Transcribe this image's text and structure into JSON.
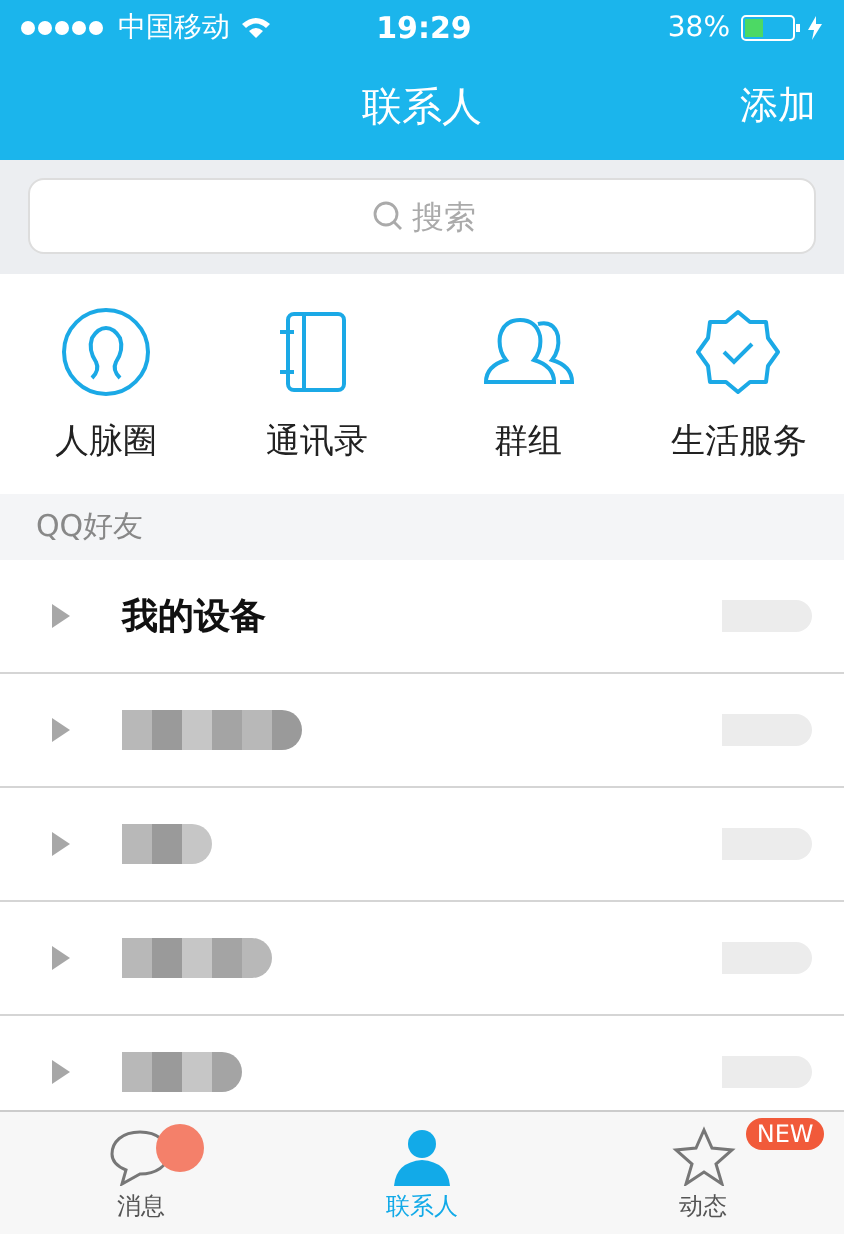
{
  "status_bar": {
    "carrier": "中国移动",
    "time": "19:29",
    "battery": "38%"
  },
  "nav": {
    "title": "联系人",
    "action": "添加"
  },
  "search": {
    "placeholder": "搜索"
  },
  "shortcuts": [
    {
      "label": "人脉圈",
      "kind": "circle"
    },
    {
      "label": "通讯录",
      "kind": "book"
    },
    {
      "label": "群组",
      "kind": "group"
    },
    {
      "label": "生活服务",
      "kind": "badge"
    }
  ],
  "section": "QQ好友",
  "groups": [
    {
      "kind": "named",
      "name": "我的设备"
    },
    {
      "kind": "blurred"
    },
    {
      "kind": "blurred"
    },
    {
      "kind": "blurred"
    },
    {
      "kind": "blurred"
    }
  ],
  "tabs": [
    {
      "label": "消息",
      "kind": "chat",
      "selected": false,
      "dot": true
    },
    {
      "label": "联系人",
      "kind": "person",
      "selected": true
    },
    {
      "label": "动态",
      "kind": "star",
      "selected": false,
      "badge": "NEW"
    }
  ]
}
